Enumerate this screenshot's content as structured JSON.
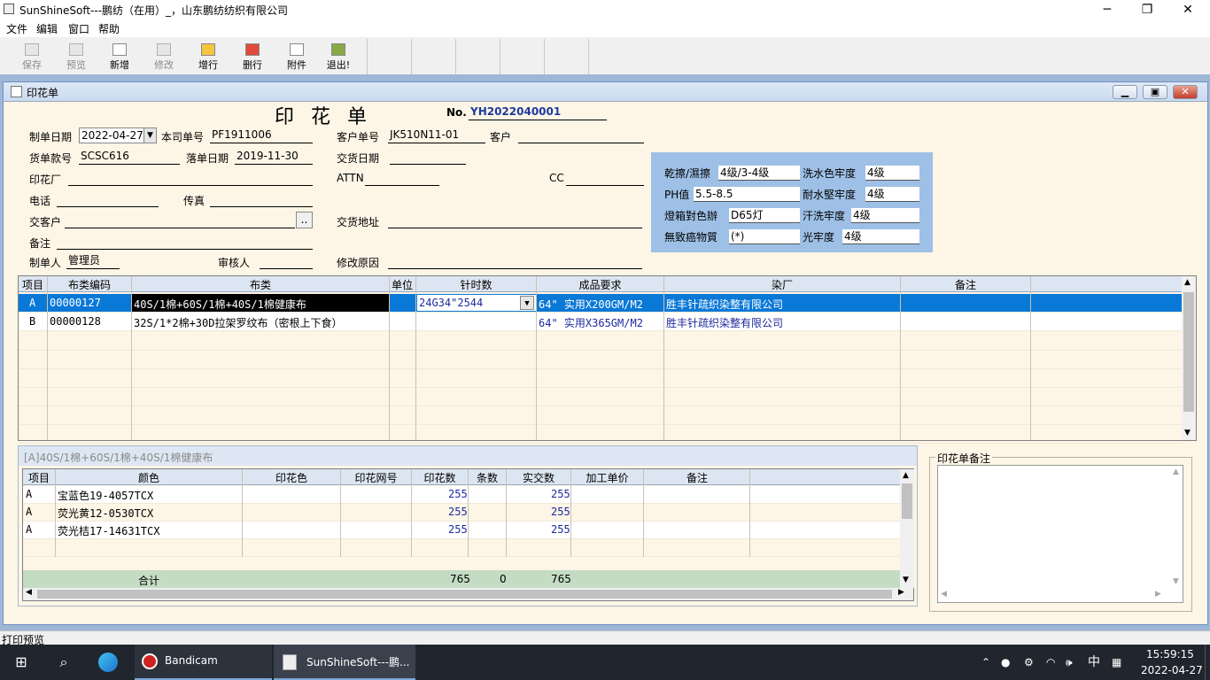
{
  "window": {
    "title": "SunShineSoft---鹏纺（在用）_，山东鹏纺纺织有限公司",
    "min": "─",
    "max": "❐",
    "close": "✕"
  },
  "menu": [
    "文件",
    "编辑",
    "窗口",
    "帮助"
  ],
  "toolbar": [
    {
      "label": "保存",
      "enabled": false,
      "icon": "save-icon"
    },
    {
      "label": "预览",
      "enabled": false,
      "icon": "preview-icon"
    },
    {
      "label": "新增",
      "enabled": true,
      "icon": "add-icon"
    },
    {
      "label": "修改",
      "enabled": false,
      "icon": "edit-icon"
    },
    {
      "label": "增行",
      "enabled": true,
      "icon": "add-row-icon"
    },
    {
      "label": "删行",
      "enabled": true,
      "icon": "delete-row-icon"
    },
    {
      "label": "附件",
      "enabled": true,
      "icon": "attachment-icon"
    },
    {
      "label": "退出!",
      "enabled": true,
      "icon": "exit-icon"
    }
  ],
  "child": {
    "title": "印花单"
  },
  "form": {
    "heading": "印 花 单",
    "no_label": "No.",
    "no_value": "YH2022040001",
    "fields": {
      "make_date_label": "制单日期",
      "make_date": "2022-04-27",
      "company_no_label": "本司单号",
      "company_no": "PF1911006",
      "customer_no_label": "客户单号",
      "customer_no": "JK510N11-01",
      "customer_label": "客户",
      "customer": "",
      "cargo_no_label": "货单款号",
      "cargo_no": "SCSC616",
      "order_date_label": "落单日期",
      "order_date": "2019-11-30",
      "delivery_date_label": "交货日期",
      "delivery_date": "",
      "printer_label": "印花厂",
      "printer": "",
      "attn_label": "ATTN",
      "attn": "",
      "cc_label": "CC",
      "cc": "",
      "phone_label": "电话",
      "phone": "",
      "fax_label": "传真",
      "fax": "",
      "delivery_customer_label": "交客户",
      "delivery_customer": "",
      "browse": "..",
      "delivery_address_label": "交货地址",
      "delivery_address": "",
      "remark_label": "备注",
      "remark": "",
      "maker_label": "制单人",
      "maker": "管理员",
      "reviewer_label": "审核人",
      "reviewer": "",
      "modify_reason_label": "修改原因",
      "modify_reason": ""
    },
    "quality": {
      "dry_wet_rub_label": "乾擦/濕擦",
      "dry_wet_rub": "4级/3-4级",
      "wash_label": "洗水色牢度",
      "wash": "4级",
      "ph_label": "PH值",
      "ph": "5.5-8.5",
      "water_label": "耐水堅牢度",
      "water": "4级",
      "light_box_label": "燈箱對色辦",
      "light_box": "D65灯",
      "sweat_label": "汗洗牢度",
      "sweat": "4级",
      "carcinogen_label": "無致癌物質",
      "carcinogen": "(*)",
      "light_label": "光牢度",
      "light": "4级"
    }
  },
  "main_grid": {
    "headers": [
      "项目",
      "布类编码",
      "布类",
      "单位",
      "针时数",
      "成品要求",
      "染厂",
      "备注"
    ],
    "rows": [
      {
        "item": "A",
        "code": "00000127",
        "fabric": "40S/1棉+60S/1棉+40S/1棉健康布",
        "unit": "",
        "needle": "24G34\"2544",
        "finish": "64\" 实用X200GM/M2",
        "dye": "胜丰针疏织染整有限公司",
        "remark": ""
      },
      {
        "item": "B",
        "code": "00000128",
        "fabric": "32S/1*2棉+30D拉架罗纹布（密根上下食）",
        "unit": "",
        "needle": "",
        "finish": "64\" 实用X365GM/M2",
        "dye": "胜丰针疏织染整有限公司",
        "remark": ""
      }
    ]
  },
  "sub_panel": {
    "title": "[A]40S/1棉+60S/1棉+40S/1棉健康布",
    "headers": [
      "项目",
      "颜色",
      "印花色",
      "印花网号",
      "印花数",
      "条数",
      "实交数",
      "加工单价",
      "备注"
    ],
    "rows": [
      {
        "item": "A",
        "color": "宝蓝色19-4057TCX",
        "qty": "255",
        "actual": "255"
      },
      {
        "item": "A",
        "color": "荧光黄12-0530TCX",
        "qty": "255",
        "actual": "255"
      },
      {
        "item": "A",
        "color": "荧光桔17-14631TCX",
        "qty": "255",
        "actual": "255"
      }
    ],
    "total": {
      "label": "合计",
      "qty": "765",
      "strips": "0",
      "actual": "765"
    }
  },
  "note_panel": {
    "title": "印花单备注",
    "text": ""
  },
  "status": "打印预览",
  "taskbar": {
    "apps": [
      "Bandicam",
      "SunShineSoft---鹏..."
    ],
    "tray_ime": "中",
    "time": "15:59:15",
    "date": "2022-04-27"
  }
}
